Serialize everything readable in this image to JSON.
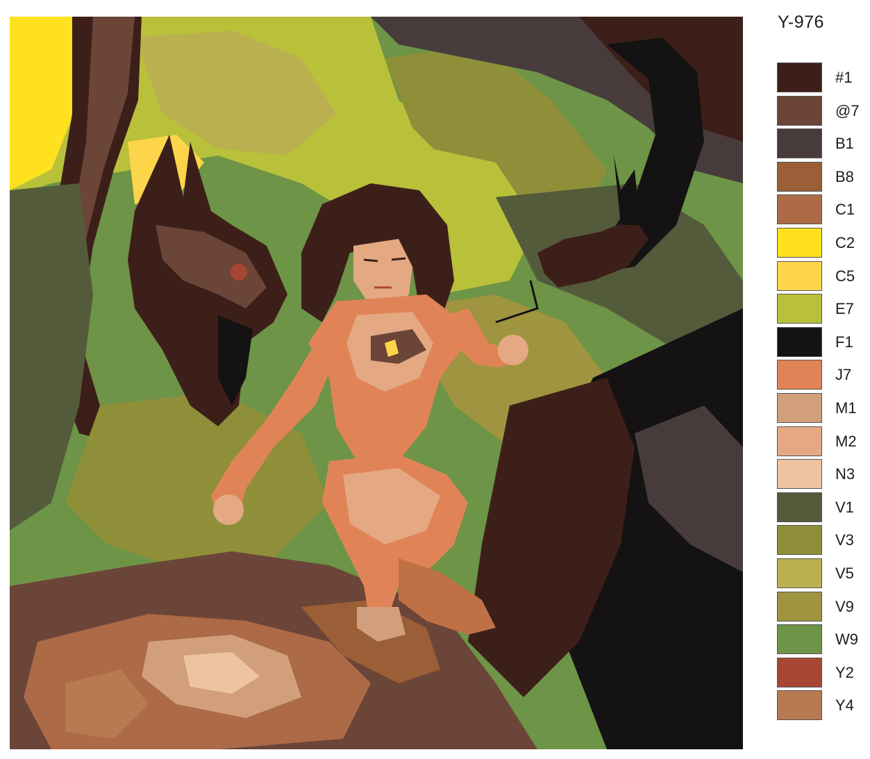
{
  "kit_code": "Y-976",
  "palette": [
    {
      "code": "#1",
      "color": "#3d1f19"
    },
    {
      "code": "@7",
      "color": "#6b4538"
    },
    {
      "code": "B1",
      "color": "#473c3b"
    },
    {
      "code": "B8",
      "color": "#9a5f36"
    },
    {
      "code": "C1",
      "color": "#ad6a47"
    },
    {
      "code": "C2",
      "color": "#ffe11f"
    },
    {
      "code": "C5",
      "color": "#fdd54a"
    },
    {
      "code": "E7",
      "color": "#b9c03a"
    },
    {
      "code": "F1",
      "color": "#141212"
    },
    {
      "code": "J7",
      "color": "#e08457"
    },
    {
      "code": "M1",
      "color": "#d19f7c"
    },
    {
      "code": "M2",
      "color": "#e4a983"
    },
    {
      "code": "N3",
      "color": "#eec3a2"
    },
    {
      "code": "V1",
      "color": "#545b3b"
    },
    {
      "code": "V3",
      "color": "#8f8f3a"
    },
    {
      "code": "V5",
      "color": "#bab04f"
    },
    {
      "code": "V9",
      "color": "#9f9440"
    },
    {
      "code": "W9",
      "color": "#6d9447"
    },
    {
      "code": "Y2",
      "color": "#a84634"
    },
    {
      "code": "Y4",
      "color": "#b87a50"
    }
  ]
}
